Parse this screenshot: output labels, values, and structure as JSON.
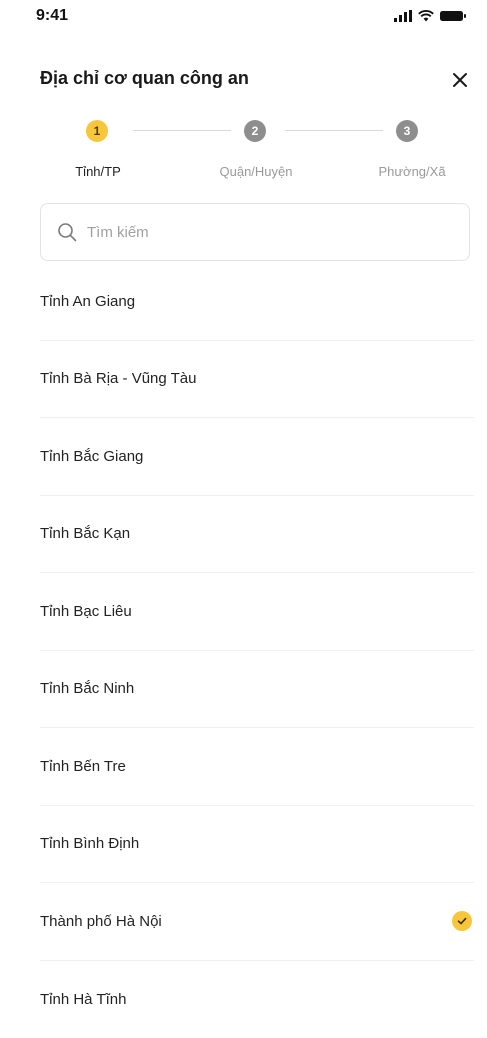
{
  "status": {
    "time": "9:41"
  },
  "header": {
    "title": "Địa chỉ cơ quan công an",
    "close_icon": "close-icon"
  },
  "steps": [
    {
      "number": "1",
      "label": "Tỉnh/TP",
      "state": "active"
    },
    {
      "number": "2",
      "label": "Quận/Huyện",
      "state": "inactive"
    },
    {
      "number": "3",
      "label": "Phường/Xã",
      "state": "inactive"
    }
  ],
  "search": {
    "placeholder": "Tìm kiếm",
    "value": "",
    "icon": "search-icon"
  },
  "list": {
    "items": [
      {
        "label": "Tỉnh An Giang",
        "selected": false
      },
      {
        "label": "Tỉnh Bà Rịa - Vũng Tàu",
        "selected": false
      },
      {
        "label": "Tỉnh Bắc Giang",
        "selected": false
      },
      {
        "label": "Tỉnh Bắc Kạn",
        "selected": false
      },
      {
        "label": "Tỉnh Bạc Liêu",
        "selected": false
      },
      {
        "label": "Tỉnh Bắc Ninh",
        "selected": false
      },
      {
        "label": "Tỉnh Bến Tre",
        "selected": false
      },
      {
        "label": "Tỉnh Bình Định",
        "selected": false
      },
      {
        "label": "Thành phố Hà Nội",
        "selected": true
      },
      {
        "label": "Tỉnh Hà Tĩnh",
        "selected": false
      }
    ]
  },
  "colors": {
    "accent": "#f7c63b",
    "inactive_step": "#8e8e8e",
    "divider": "#efefef"
  }
}
